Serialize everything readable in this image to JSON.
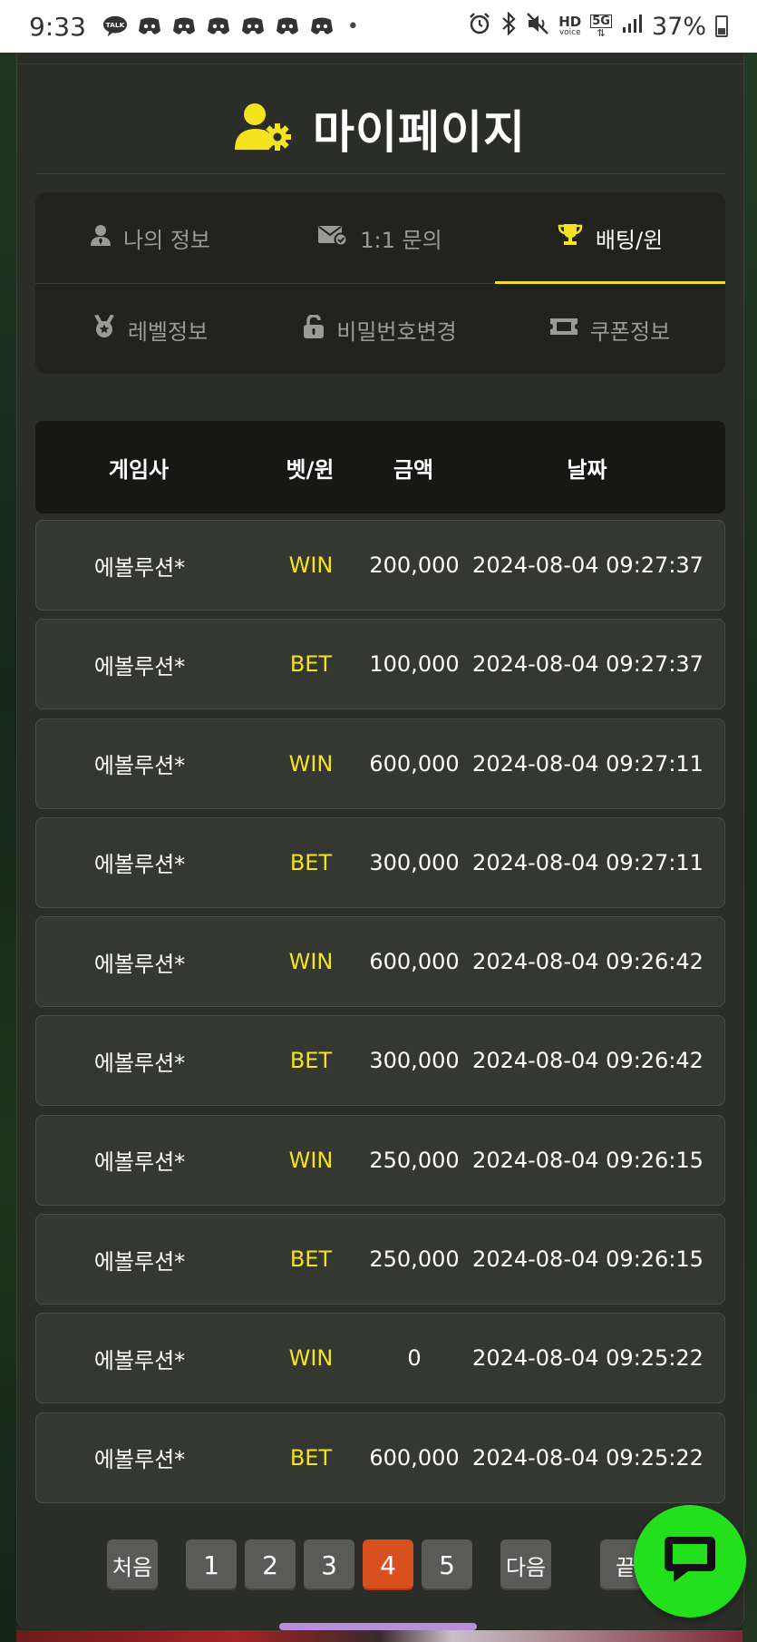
{
  "status_bar": {
    "time": "9:33",
    "notification_icons": [
      "talk-icon",
      "discord-icon",
      "discord-icon",
      "discord-icon",
      "discord-icon",
      "discord-icon",
      "discord-icon"
    ],
    "dot": "•",
    "hd_label": "HD",
    "voice_label": "voice",
    "network_label": "5G",
    "battery": "37%"
  },
  "header": {
    "title": "마이페이지",
    "accent_color": "#f5e31f"
  },
  "tabs": [
    {
      "label": "나의 정보",
      "icon": "user-icon",
      "active": false
    },
    {
      "label": "1:1 문의",
      "icon": "envelope-check-icon",
      "active": false
    },
    {
      "label": "배팅/윈",
      "icon": "trophy-icon",
      "active": true
    },
    {
      "label": "레벨정보",
      "icon": "medal-icon",
      "active": false
    },
    {
      "label": "비밀번호변경",
      "icon": "unlock-icon",
      "active": false
    },
    {
      "label": "쿠폰정보",
      "icon": "ticket-icon",
      "active": false
    }
  ],
  "table": {
    "headers": [
      "게임사",
      "벳/윈",
      "금액",
      "날짜"
    ],
    "rows": [
      {
        "provider": "에볼루션*",
        "type": "WIN",
        "amount": "200,000",
        "date": "2024-08-04 09:27:37"
      },
      {
        "provider": "에볼루션*",
        "type": "BET",
        "amount": "100,000",
        "date": "2024-08-04 09:27:37"
      },
      {
        "provider": "에볼루션*",
        "type": "WIN",
        "amount": "600,000",
        "date": "2024-08-04 09:27:11"
      },
      {
        "provider": "에볼루션*",
        "type": "BET",
        "amount": "300,000",
        "date": "2024-08-04 09:27:11"
      },
      {
        "provider": "에볼루션*",
        "type": "WIN",
        "amount": "600,000",
        "date": "2024-08-04 09:26:42"
      },
      {
        "provider": "에볼루션*",
        "type": "BET",
        "amount": "300,000",
        "date": "2024-08-04 09:26:42"
      },
      {
        "provider": "에볼루션*",
        "type": "WIN",
        "amount": "250,000",
        "date": "2024-08-04 09:26:15"
      },
      {
        "provider": "에볼루션*",
        "type": "BET",
        "amount": "250,000",
        "date": "2024-08-04 09:26:15"
      },
      {
        "provider": "에볼루션*",
        "type": "WIN",
        "amount": "0",
        "date": "2024-08-04 09:25:22"
      },
      {
        "provider": "에볼루션*",
        "type": "BET",
        "amount": "600,000",
        "date": "2024-08-04 09:25:22"
      }
    ]
  },
  "pagination": {
    "first": "처음",
    "pages": [
      "1",
      "2",
      "3",
      "4",
      "5"
    ],
    "current": "4",
    "next": "다음",
    "last": "끝",
    "active_color": "#d9501f"
  },
  "chat_fab": {
    "icon": "chat-bubble-icon",
    "color": "#22e01c"
  }
}
